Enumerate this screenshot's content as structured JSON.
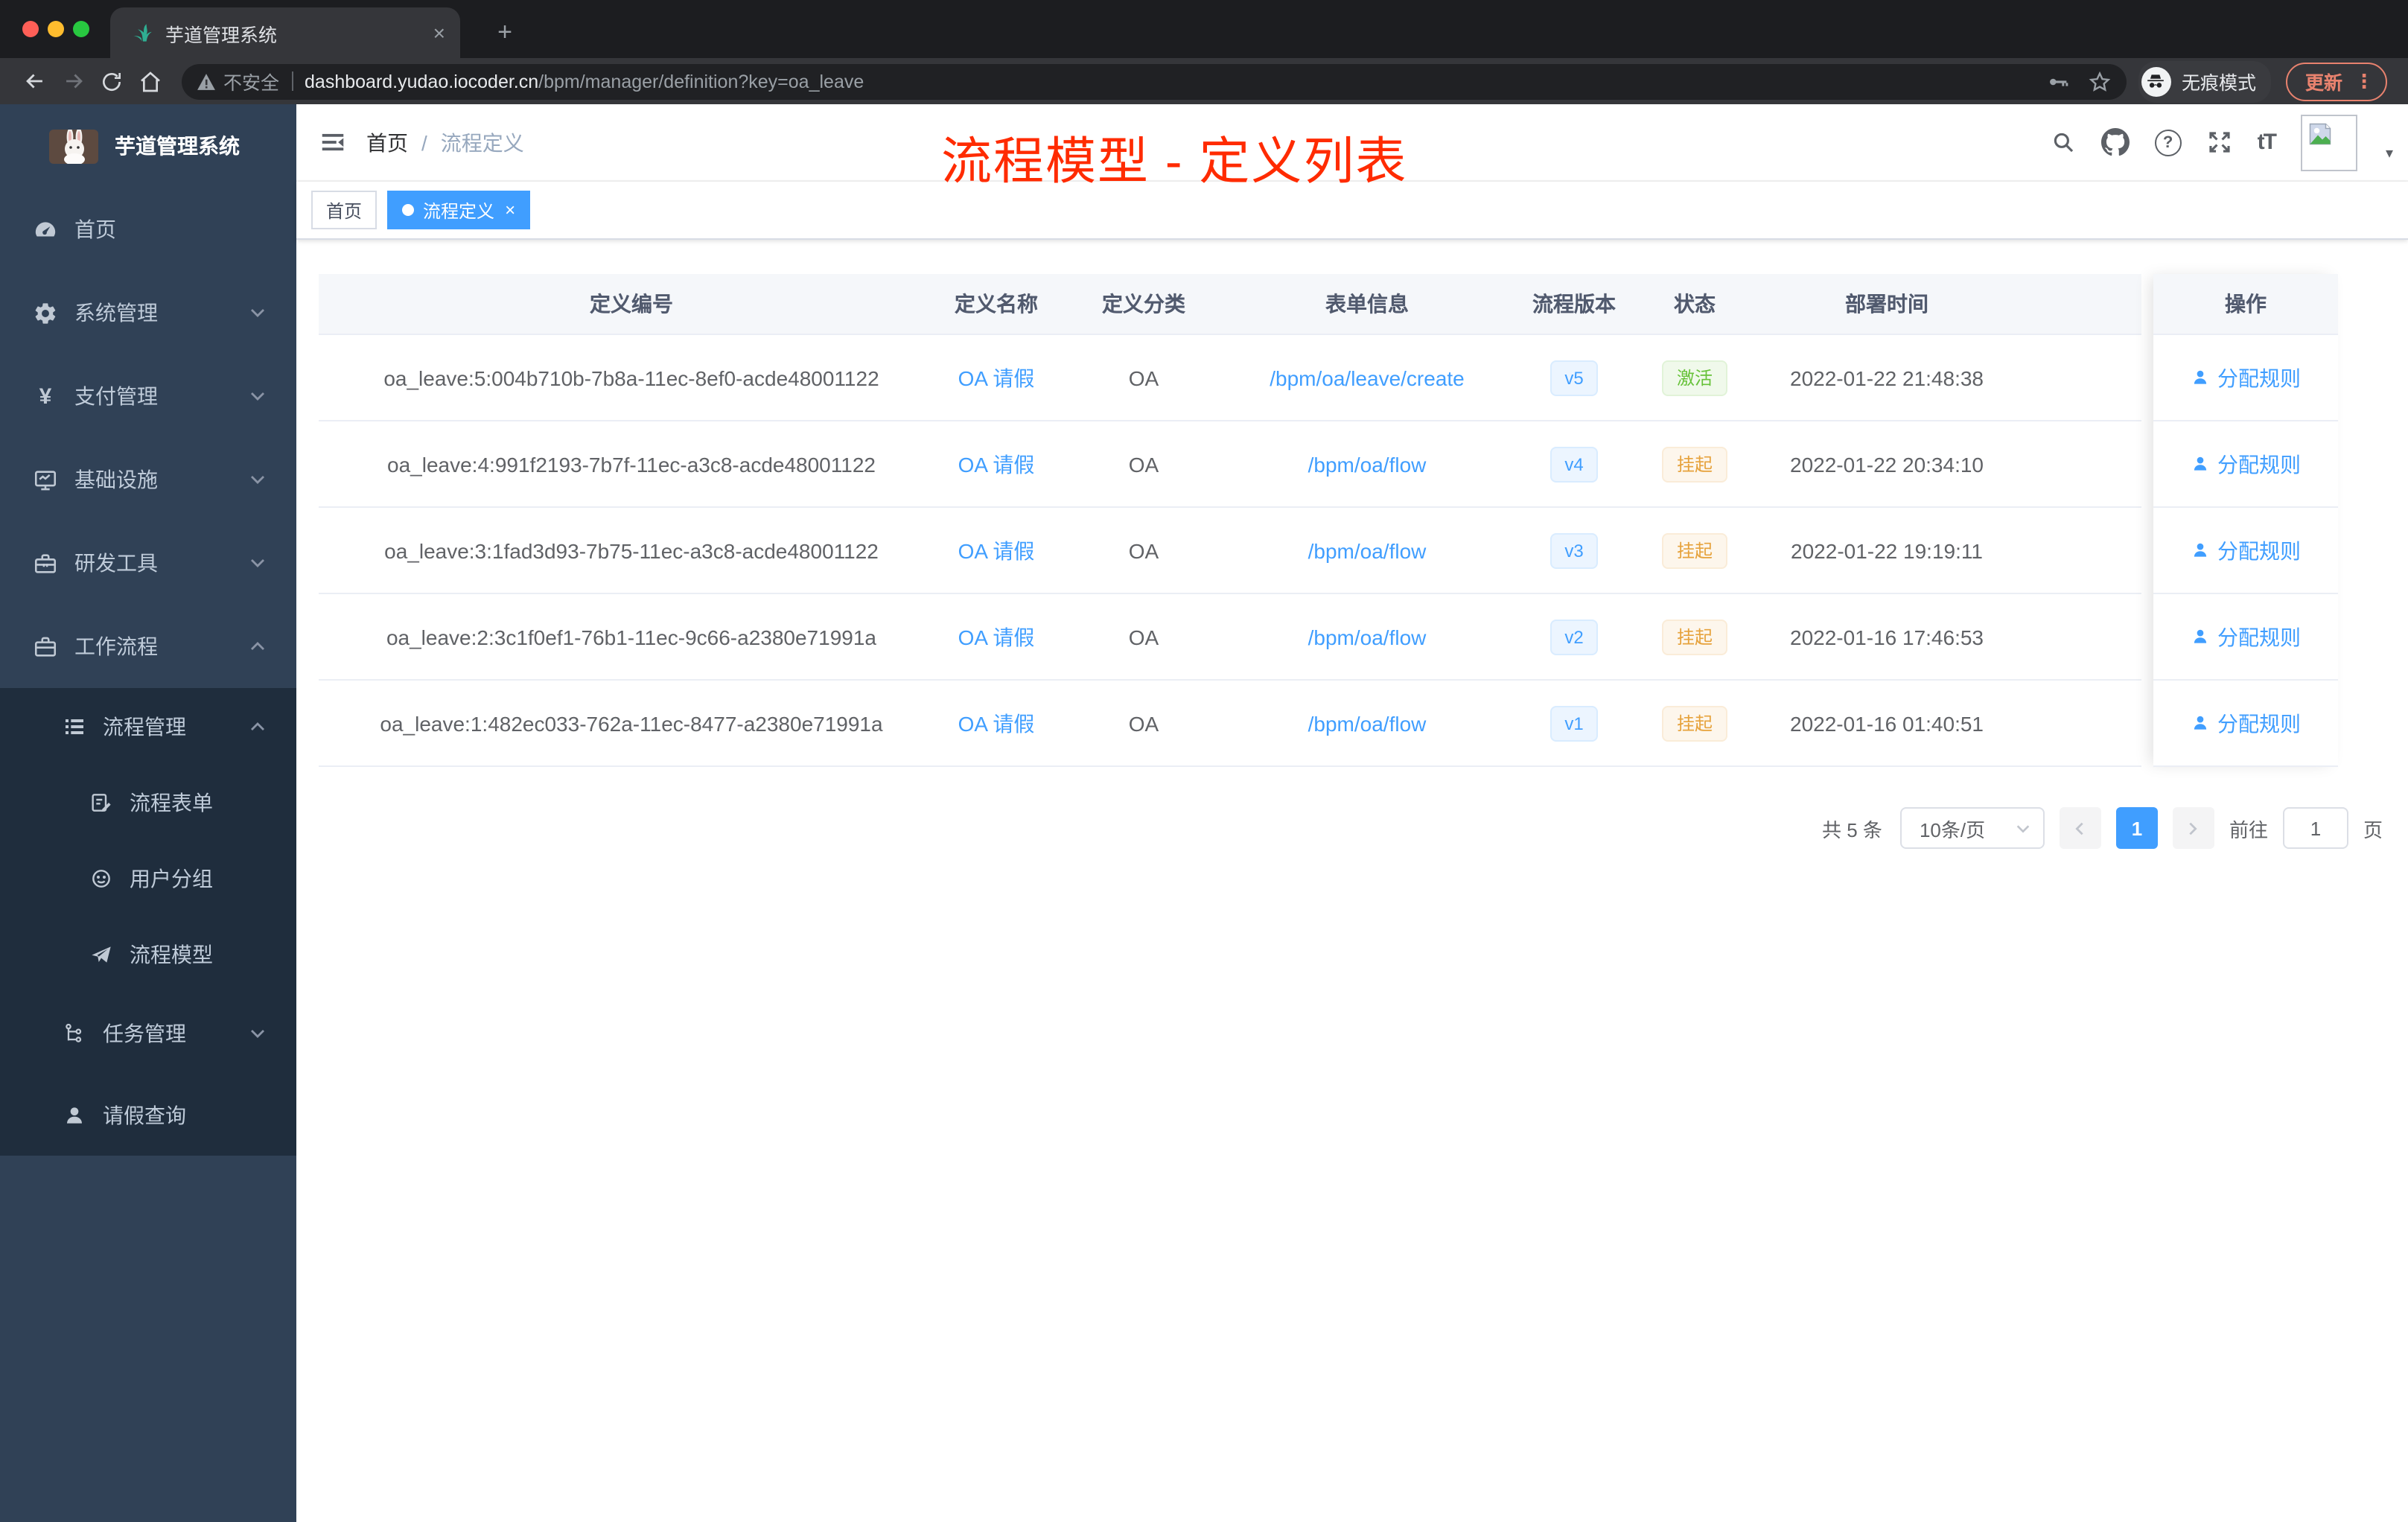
{
  "colors": {
    "primary": "#409eff",
    "success_text": "#67c23a",
    "warning_text": "#e6a23c",
    "annotation_red": "#ff2b00",
    "sidebar_bg": "#304156",
    "sidebar_submenu_bg": "#1f2d3d"
  },
  "browser": {
    "tab": {
      "title": "芋道管理系统"
    },
    "address": {
      "security_label": "不安全",
      "domain": "dashboard.yudao.iocoder.cn",
      "path": "/bpm/manager/definition?key=oa_leave"
    },
    "incognito_label": "无痕模式",
    "update_label": "更新"
  },
  "sidebar": {
    "logo_title": "芋道管理系统",
    "items": [
      {
        "label": "首页"
      },
      {
        "label": "系统管理"
      },
      {
        "label": "支付管理"
      },
      {
        "label": "基础设施"
      },
      {
        "label": "研发工具"
      },
      {
        "label": "工作流程"
      },
      {
        "label": "流程管理"
      },
      {
        "label": "流程表单"
      },
      {
        "label": "用户分组"
      },
      {
        "label": "流程模型"
      },
      {
        "label": "任务管理"
      },
      {
        "label": "请假查询"
      }
    ]
  },
  "navbar": {
    "breadcrumb": {
      "home": "首页",
      "separator": "/",
      "current": "流程定义"
    }
  },
  "annotation": {
    "title": "流程模型 - 定义列表"
  },
  "tags": {
    "home": "首页",
    "active": "流程定义"
  },
  "table": {
    "columns": [
      "定义编号",
      "定义名称",
      "定义分类",
      "表单信息",
      "流程版本",
      "状态",
      "部署时间",
      "操作"
    ],
    "action_label": "分配规则",
    "rows": [
      {
        "id": "oa_leave:5:004b710b-7b8a-11ec-8ef0-acde48001122",
        "name": "OA 请假",
        "category": "OA",
        "form": "/bpm/oa/leave/create",
        "version": "v5",
        "status": "激活",
        "deployed_at": "2022-01-22 21:48:38"
      },
      {
        "id": "oa_leave:4:991f2193-7b7f-11ec-a3c8-acde48001122",
        "name": "OA 请假",
        "category": "OA",
        "form": "/bpm/oa/flow",
        "version": "v4",
        "status": "挂起",
        "deployed_at": "2022-01-22 20:34:10"
      },
      {
        "id": "oa_leave:3:1fad3d93-7b75-11ec-a3c8-acde48001122",
        "name": "OA 请假",
        "category": "OA",
        "form": "/bpm/oa/flow",
        "version": "v3",
        "status": "挂起",
        "deployed_at": "2022-01-22 19:19:11"
      },
      {
        "id": "oa_leave:2:3c1f0ef1-76b1-11ec-9c66-a2380e71991a",
        "name": "OA 请假",
        "category": "OA",
        "form": "/bpm/oa/flow",
        "version": "v2",
        "status": "挂起",
        "deployed_at": "2022-01-16 17:46:53"
      },
      {
        "id": "oa_leave:1:482ec033-762a-11ec-8477-a2380e71991a",
        "name": "OA 请假",
        "category": "OA",
        "form": "/bpm/oa/flow",
        "version": "v1",
        "status": "挂起",
        "deployed_at": "2022-01-16 01:40:51"
      }
    ]
  },
  "pagination": {
    "total": "共 5 条",
    "page_size": "10条/页",
    "page": "1",
    "goto": "前往",
    "goto_value": "1",
    "unit": "页"
  },
  "icons": {
    "close": "×",
    "plus": "+",
    "kebab": "⋮",
    "caret": "▾",
    "yen": "¥",
    "font_size": "tT",
    "help": "?"
  }
}
